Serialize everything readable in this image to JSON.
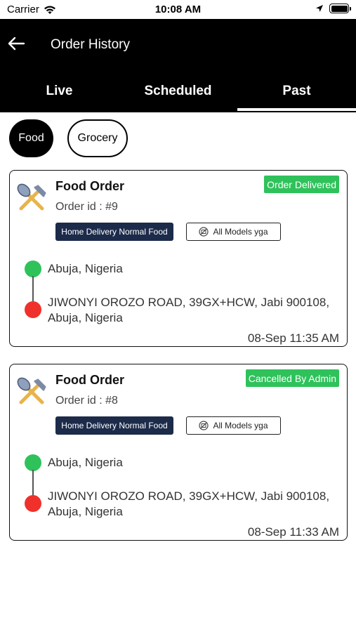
{
  "status_bar": {
    "carrier": "Carrier",
    "time": "10:08 AM"
  },
  "header": {
    "title": "Order History",
    "tabs": [
      {
        "label": "Live"
      },
      {
        "label": "Scheduled"
      },
      {
        "label": "Past",
        "active": true
      }
    ]
  },
  "filters": {
    "food": "Food",
    "grocery": "Grocery",
    "selected": "Food"
  },
  "orders": [
    {
      "title": "Food Order",
      "order_id": "Order id : #9",
      "status": "Order Delivered",
      "delivery_type": "Home Delivery Normal Food",
      "model": "All Models yga",
      "pickup": "Abuja, Nigeria",
      "drop": "JIWONYI OROZO ROAD, 39GX+HCW, Jabi 900108, Abuja, Nigeria",
      "timestamp": "08-Sep 11:35 AM"
    },
    {
      "title": "Food Order",
      "order_id": "Order id : #8",
      "status": "Cancelled By Admin",
      "delivery_type": "Home Delivery Normal Food",
      "model": "All Models yga",
      "pickup": "Abuja, Nigeria",
      "drop": "JIWONYI OROZO ROAD, 39GX+HCW, Jabi 900108, Abuja, Nigeria",
      "timestamp": "08-Sep 11:33 AM"
    }
  ],
  "colors": {
    "header_bg": "#000000",
    "status_green": "#2fc25b",
    "drop_red": "#f0312b",
    "tag_navy": "#1c2b4a"
  },
  "icons": [
    "back-arrow-icon",
    "wifi-icon",
    "location-arrow-icon",
    "battery-icon",
    "fork-spoon-icon",
    "model-icon"
  ]
}
